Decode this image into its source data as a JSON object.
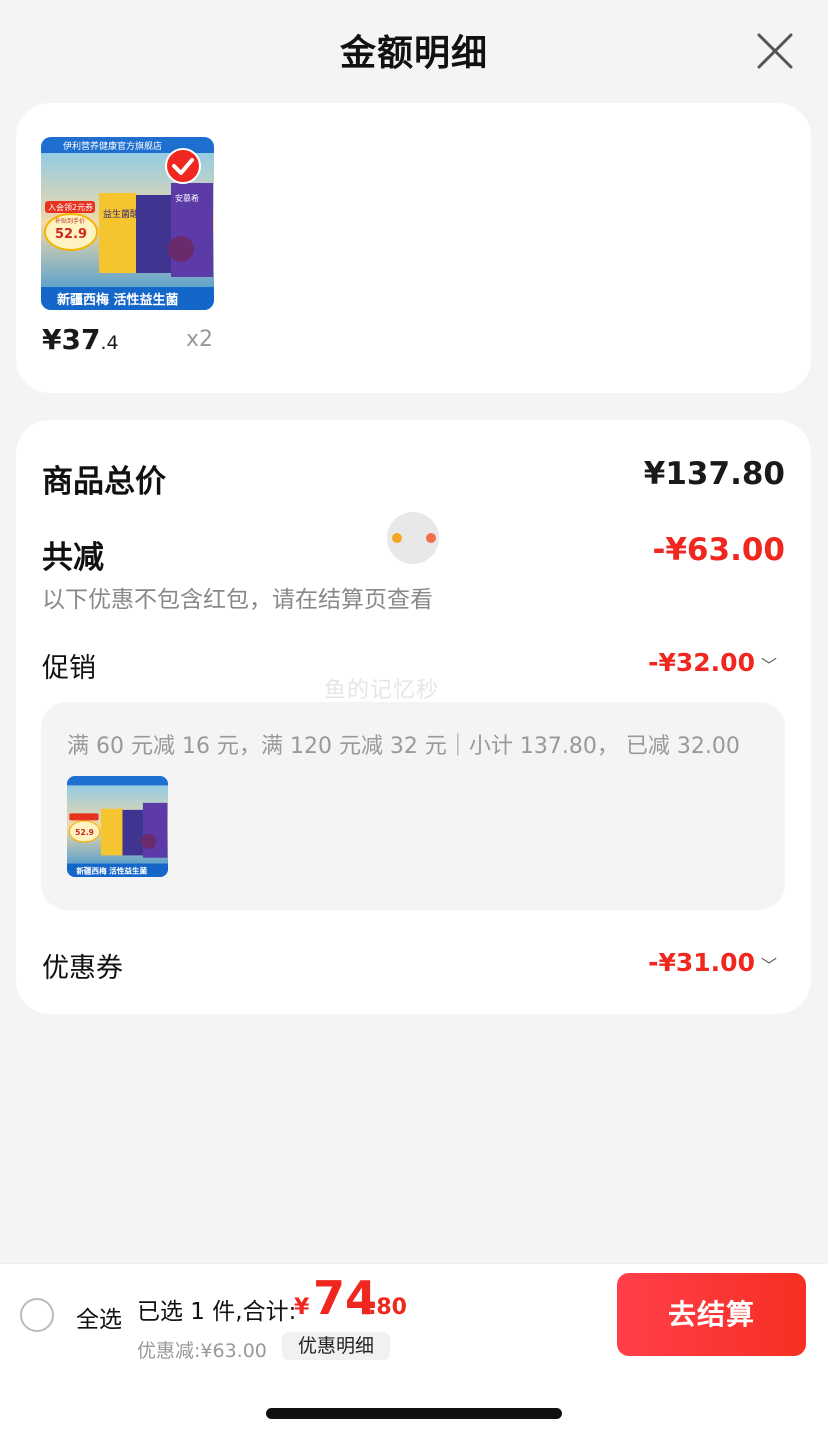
{
  "header": {
    "title": "金额明细"
  },
  "product": {
    "price_int": "¥37",
    "price_dec": ".4",
    "quantity": "x2",
    "image": {
      "store_name": "伊利营养健康官方旗舰店",
      "coupon_tag": "入会领2元券",
      "subsidy_label": "补贴到手价",
      "subsidy_price": "52.9",
      "slogan": "新疆西梅 活性益生菌",
      "pack_label": "益生菌酸奶",
      "brand_label": "安慕希"
    }
  },
  "summary": {
    "total_label": "商品总价",
    "total_value": "¥137.80",
    "reduce_label": "共减",
    "reduce_value": "-¥63.00",
    "note": "以下优惠不包含红包，请在结算页查看",
    "promo_label": "促销",
    "promo_value": "-¥32.00",
    "promo_detail": "满 60 元减 16 元，满 120 元减 32 元｜小计 137.80， 已减 32.00",
    "coupon_label": "优惠券",
    "coupon_value": "-¥31.00"
  },
  "watermark": "鱼的记忆秒",
  "bottom_bar": {
    "select_all": "全选",
    "selected_info": "已选 1 件,合计:",
    "total_symbol": "¥",
    "total_int": "74",
    "total_dec": ".80",
    "discount_text": "优惠减:¥63.00",
    "detail_chip": "优惠明细",
    "checkout": "去结算"
  },
  "colors": {
    "accent_red": "#f0271f",
    "checkout_gradient_start": "#ff3f4a",
    "checkout_gradient_end": "#f72f22"
  },
  "icons": {
    "close": "close-icon",
    "check": "check-badge-icon",
    "chevron": "chevron-down-icon",
    "loading": "loading-dots-icon"
  }
}
